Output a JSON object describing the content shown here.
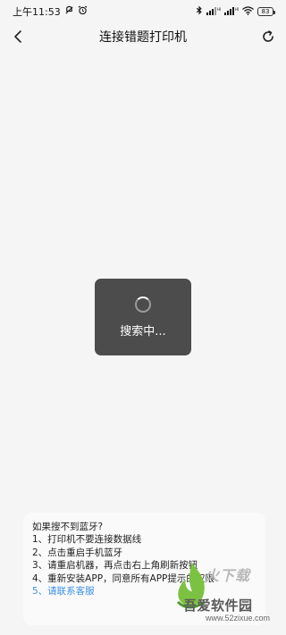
{
  "status_bar": {
    "time": "上午11:53",
    "battery": "83"
  },
  "nav": {
    "title": "连接错题打印机"
  },
  "loading": {
    "text": "搜索中..."
  },
  "help": {
    "heading": "如果搜不到蓝牙?",
    "items": [
      "1、打印机不要连接数据线",
      "2、点击重启手机蓝牙",
      "3、请重启机器，再点击右上角刷新按钮",
      "4、重新安装APP，同意所有APP提示的权限"
    ],
    "contact_link": "5、请联系客服"
  },
  "watermark": {
    "partial_text": "火下载",
    "site_name": "吾爱软件园",
    "url": "www.52zixue.com"
  },
  "colors": {
    "link": "#3d8fe6",
    "toast_bg": "#4c4c4c",
    "page_bg": "#f5f5f5"
  }
}
